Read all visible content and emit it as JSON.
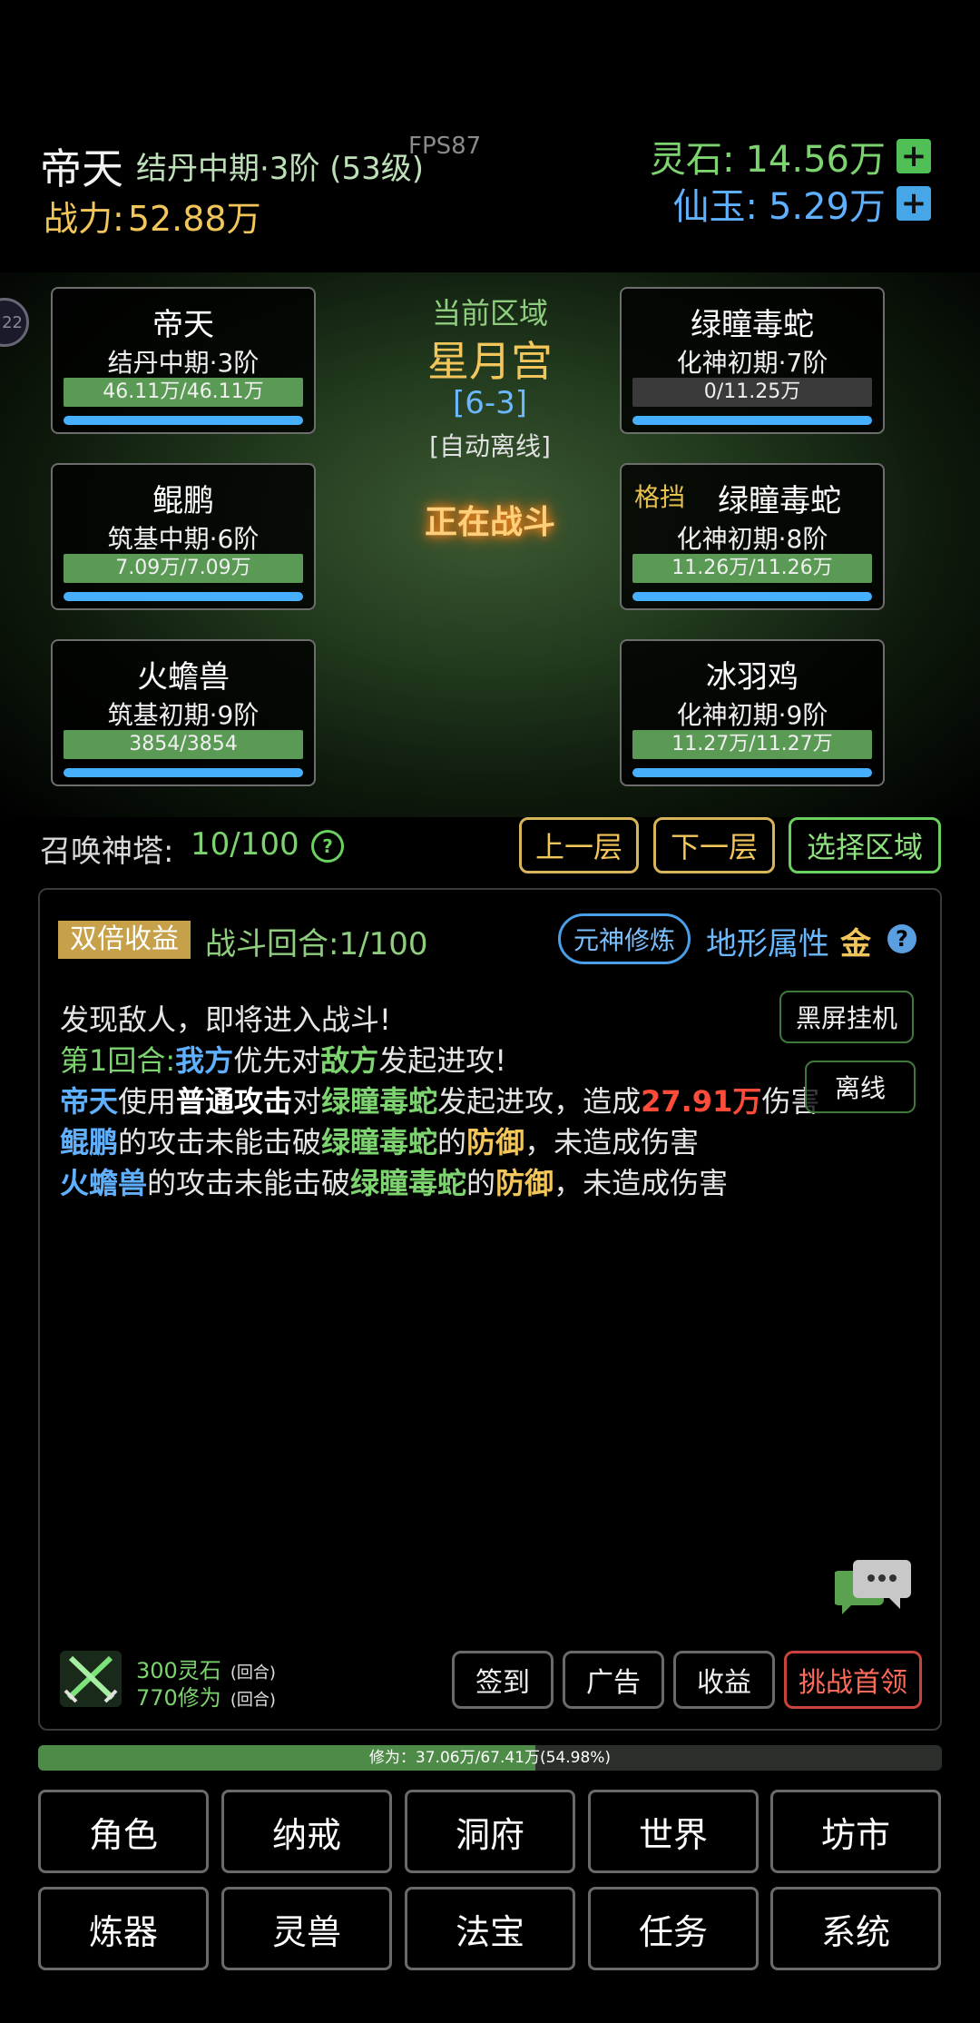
{
  "header": {
    "player_name": "帝天",
    "realm": "结丹中期·3阶 (53级)",
    "fps": "FPS87",
    "power_label": "战力:",
    "power_value": "52.88万",
    "lingshi_label": "灵石:",
    "lingshi_value": "14.56万",
    "xianyu_label": "仙玉:",
    "xianyu_value": "5.29万",
    "plus_glyph": "+"
  },
  "side_avatar_text": "22",
  "allies": [
    {
      "name": "帝天",
      "rank": "结丹中期·3阶",
      "hp": "46.11万/46.11万",
      "hp_ratio": 1.0
    },
    {
      "name": "鲲鹏",
      "rank": "筑基中期·6阶",
      "hp": "7.09万/7.09万",
      "hp_ratio": 1.0
    },
    {
      "name": "火蟾兽",
      "rank": "筑基初期·9阶",
      "hp": "3854/3854",
      "hp_ratio": 1.0
    }
  ],
  "enemies": [
    {
      "tag": "",
      "name": "绿瞳毒蛇",
      "rank": "化神初期·7阶",
      "hp": "0/11.25万",
      "hp_ratio": 0.0
    },
    {
      "tag": "格挡",
      "name": "绿瞳毒蛇",
      "rank": "化神初期·8阶",
      "hp": "11.26万/11.26万",
      "hp_ratio": 1.0
    },
    {
      "tag": "",
      "name": "冰羽鸡",
      "rank": "化神初期·9阶",
      "hp": "11.27万/11.27万",
      "hp_ratio": 1.0
    }
  ],
  "area": {
    "label": "当前区域",
    "name": "星月宫",
    "code": "[6-3]",
    "mode": "[自动离线]",
    "status": "正在战斗"
  },
  "tower": {
    "label": "召唤神塔:",
    "value": "10/100",
    "help": "?",
    "prev_btn": "上一层",
    "next_btn": "下一层",
    "select_btn": "选择区域"
  },
  "log_panel": {
    "double_label": "双倍收益",
    "round_label": "战斗回合:",
    "round_value": "1/100",
    "yuanshen_btn": "元神修炼",
    "terrain_label": "地形属性",
    "terrain_value": "金",
    "terrain_help": "?",
    "blackscreen_btn": "黑屏挂机",
    "offline_btn": "离线",
    "lines": {
      "l1": "发现敌人，即将进入战斗!",
      "l2_a": "第1回合:",
      "l2_b": "我方",
      "l2_c": "优先对",
      "l2_d": "敌方",
      "l2_e": "发起进攻!",
      "l3_a": "帝天",
      "l3_b": "使用",
      "l3_c": "普通攻击",
      "l3_d": "对",
      "l3_e": "绿瞳毒蛇",
      "l3_f": "发起进攻，造成",
      "l3_g": "27.91万",
      "l3_h": "伤害",
      "l4_a": "鲲鹏",
      "l4_b": "的攻击未能击破",
      "l4_c": "绿瞳毒蛇",
      "l4_d": "的",
      "l4_e": "防御",
      "l4_f": "，未造成伤害",
      "l5_a": "火蟾兽",
      "l5_b": "的攻击未能击破",
      "l5_c": "绿瞳毒蛇",
      "l5_d": "的",
      "l5_e": "防御",
      "l5_f": "，未造成伤害"
    },
    "reward_lingshi": "300灵石",
    "reward_xiuwei": "770修为",
    "reward_unit": "(回合)",
    "btn_signin": "签到",
    "btn_ad": "广告",
    "btn_income": "收益",
    "btn_boss": "挑战首领"
  },
  "cultivation": {
    "text": "修为：37.06万/67.41万(54.98%)",
    "progress": 0.5498
  },
  "nav": {
    "r1": [
      "角色",
      "纳戒",
      "洞府",
      "世界",
      "坊市"
    ],
    "r2": [
      "炼器",
      "灵兽",
      "法宝",
      "任务",
      "系统"
    ]
  }
}
